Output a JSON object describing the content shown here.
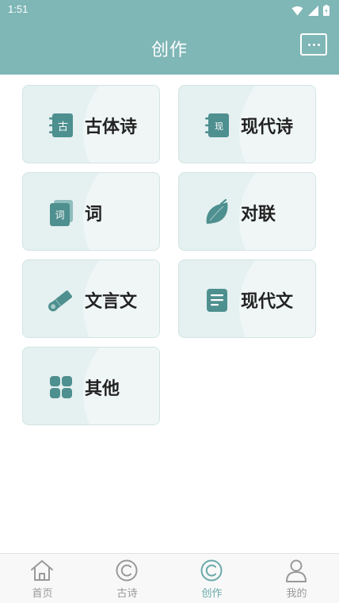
{
  "status_bar": {
    "time": "1:51",
    "icons": [
      "wifi-icon",
      "cellular-signal-icon",
      "battery-icon"
    ]
  },
  "header": {
    "title": "创作",
    "message_button_icon": "chat-bubble-icon"
  },
  "categories": [
    {
      "label": "古体诗",
      "icon": "notebook-gu-icon",
      "badge_text": "古"
    },
    {
      "label": "现代诗",
      "icon": "notebook-xian-icon",
      "badge_text": "现"
    },
    {
      "label": "词",
      "icon": "cards-ci-icon",
      "badge_text": "词"
    },
    {
      "label": "对联",
      "icon": "leaf-icon"
    },
    {
      "label": "文言文",
      "icon": "scroll-icon"
    },
    {
      "label": "现代文",
      "icon": "document-icon"
    },
    {
      "label": "其他",
      "icon": "grid-icon"
    }
  ],
  "tabs": [
    {
      "label": "首页",
      "icon": "home-icon",
      "active": false
    },
    {
      "label": "古诗",
      "icon": "copyright-circle-icon",
      "active": false
    },
    {
      "label": "创作",
      "icon": "copyright-circle-icon",
      "active": true
    },
    {
      "label": "我的",
      "icon": "person-icon",
      "active": false
    }
  ],
  "colors": {
    "primary": "#7fb6b6",
    "icon": "#4e8f8f",
    "card_background": "#e5f0f0",
    "tab_active": "#6aa9a9",
    "tab_inactive": "#999999"
  }
}
